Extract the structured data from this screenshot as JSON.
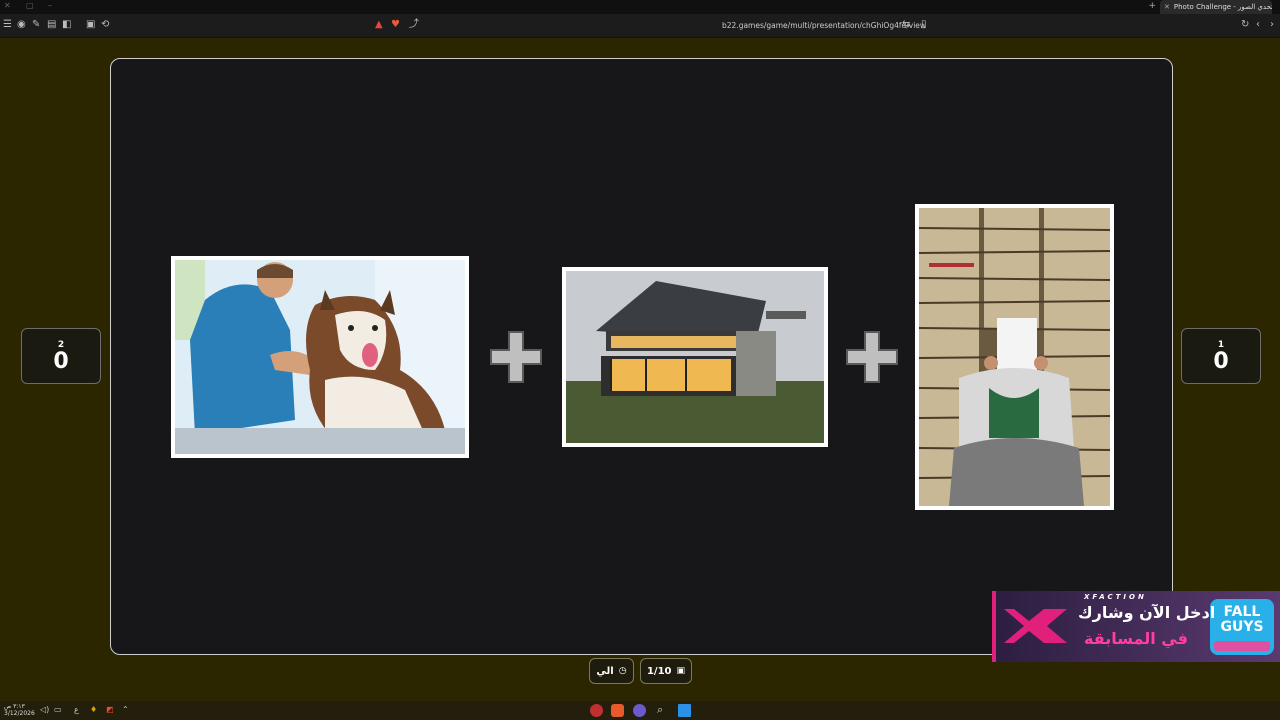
{
  "browser": {
    "tab_title": "Photo Challenge - تحدي الصور",
    "url": "b22.games/game/multi/presentation/chGhiOg4fd/view"
  },
  "scores": {
    "left": {
      "player": "2",
      "points": "0"
    },
    "right": {
      "player": "1",
      "points": "0"
    }
  },
  "photos": [
    {
      "name": "veterinarian with husky dog"
    },
    {
      "name": "modern two-story house at dusk"
    },
    {
      "name": "person reading among stacks of books"
    }
  ],
  "controls": {
    "mode_label": "الي",
    "progress": "1/10"
  },
  "ad": {
    "brand_top": "XFACTION",
    "headline": "ادخل الآن وشارك",
    "subline": "في المسابقة",
    "game": "FALL GUYS"
  },
  "taskbar": {
    "time": "٣:١٣ ص",
    "date": "3/12/2026",
    "lang": "ع"
  },
  "colors": {
    "page_bg": "#2b2500",
    "card_bg": "#17171a",
    "card_border": "#cfcfcf"
  }
}
